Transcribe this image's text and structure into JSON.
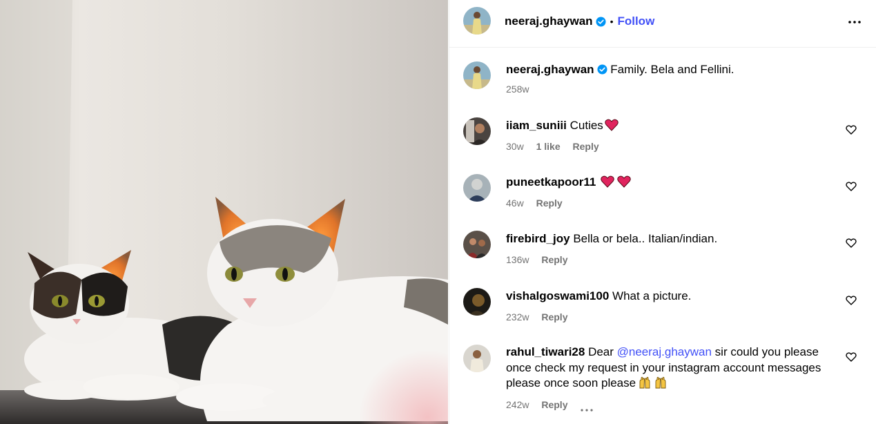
{
  "post": {
    "image_alt": "Two cats, Bela and Fellini",
    "author": "neeraj.ghaywan",
    "follow_label": "Follow",
    "separator": "•",
    "caption": "Family. Bela and Fellini.",
    "caption_age": "258w"
  },
  "colors": {
    "link": "#4150f7",
    "muted": "#737373",
    "verified": "#0095f6",
    "heart": "#e0245e"
  },
  "comments": [
    {
      "username": "iiam_suniii",
      "text": "Cuties",
      "emoji": [
        "red-heart"
      ],
      "age": "30w",
      "likes": "1 like",
      "reply": "Reply"
    },
    {
      "username": "puneetkapoor11",
      "text": "",
      "emoji": [
        "red-heart",
        "red-heart"
      ],
      "age": "46w",
      "reply": "Reply"
    },
    {
      "username": "firebird_joy",
      "text": "Bella or bela.. Italian/indian.",
      "age": "136w",
      "reply": "Reply"
    },
    {
      "username": "vishalgoswami100",
      "text": "What a picture.",
      "age": "232w",
      "reply": "Reply"
    },
    {
      "username": "rahul_tiwari28",
      "text_before": "Dear ",
      "mention": "@neeraj.ghaywan",
      "text_after": " sir could you please once check my request in your instagram account messages please once soon please",
      "emoji": [
        "raising-hands",
        "raising-hands"
      ],
      "age": "242w",
      "reply": "Reply"
    }
  ]
}
